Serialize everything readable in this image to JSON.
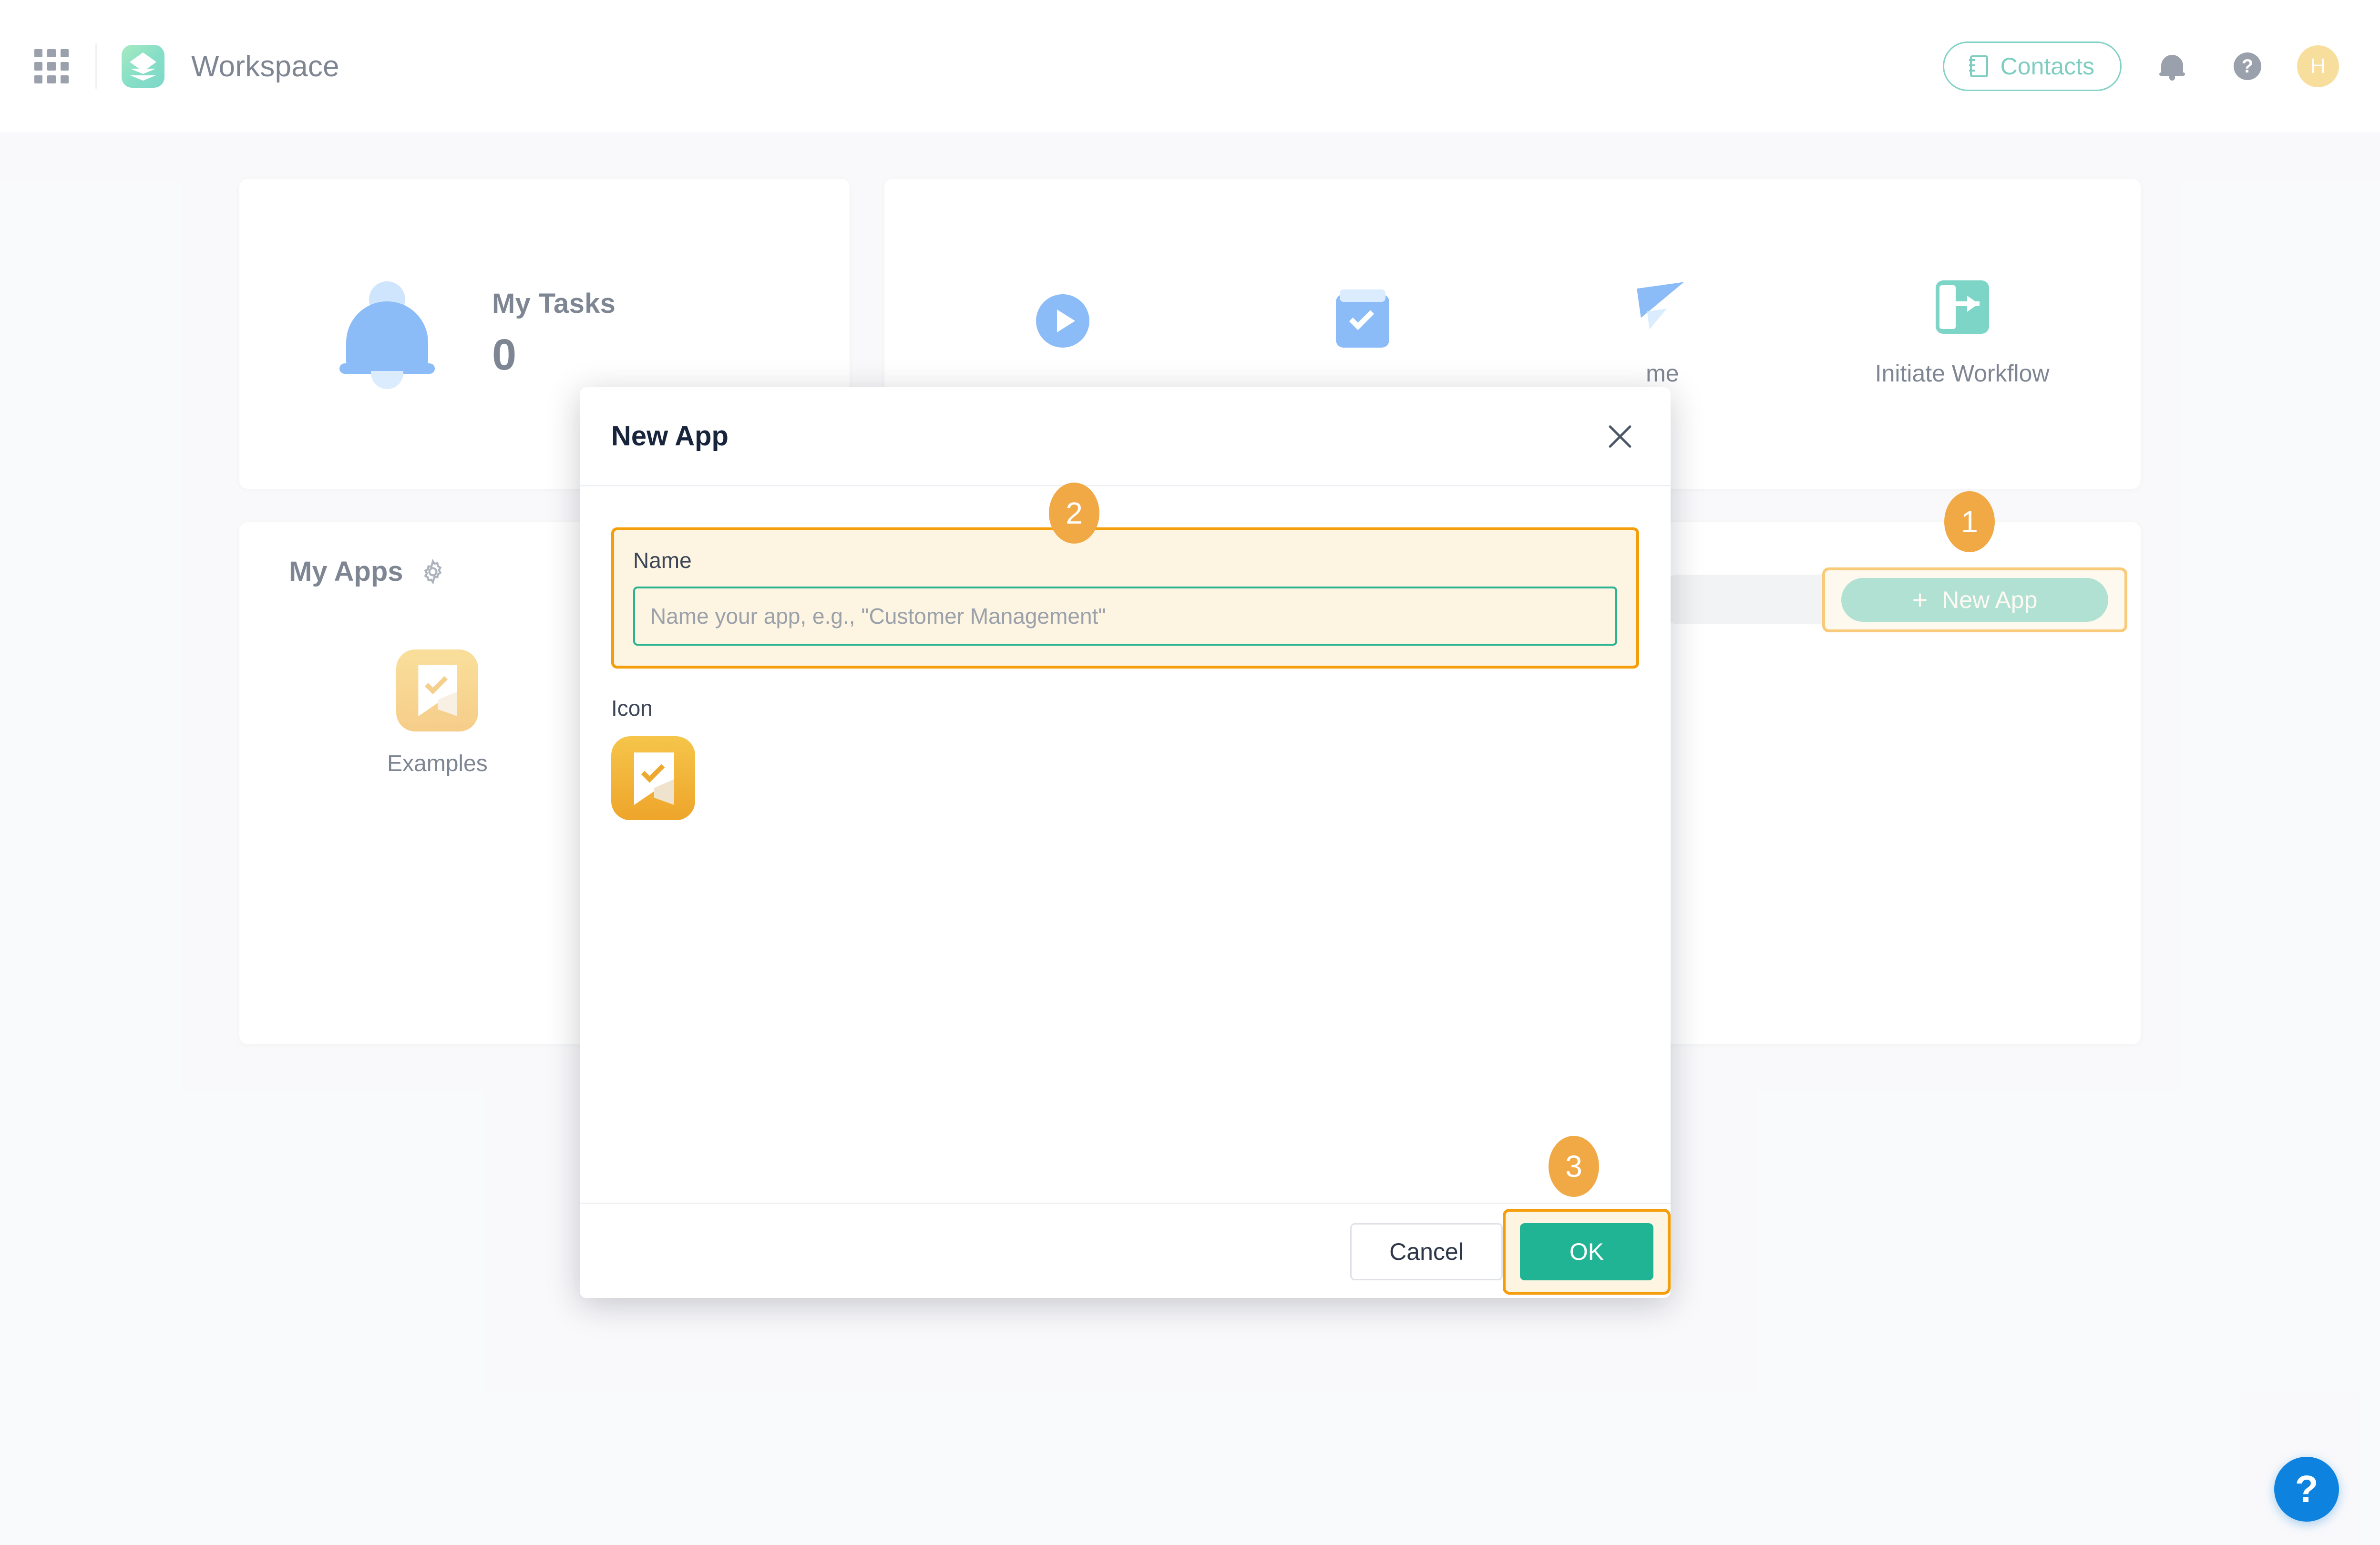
{
  "topbar": {
    "apps_grid_icon": "grid-apps-icon",
    "brand_logo_icon": "workspace-logo-icon",
    "brand_name": "Workspace",
    "contacts_label": "Contacts",
    "contacts_icon": "contacts-book-icon",
    "notifications_icon": "bell-icon",
    "help_icon": "help-circle-icon",
    "avatar_initial": "H"
  },
  "tasks_card": {
    "icon": "bell-icon",
    "title": "My Tasks",
    "count": "0"
  },
  "actions_card": {
    "items": [
      {
        "icon": "play-circle-icon",
        "label": ""
      },
      {
        "icon": "checkbox-inbox-icon",
        "label": ""
      },
      {
        "icon": "paper-plane-icon",
        "label": "me"
      },
      {
        "icon": "initiate-workflow-icon",
        "label": "Initiate Workflow"
      }
    ]
  },
  "apps_card": {
    "title": "My Apps",
    "settings_icon": "gear-icon",
    "apps": [
      {
        "name": "Examples",
        "icon": "bookmark-check-icon"
      }
    ],
    "search_placeholder": "",
    "new_app_label": "New App",
    "new_app_plus": "+"
  },
  "dialog": {
    "title": "New App",
    "close_icon": "close-icon",
    "name_label": "Name",
    "name_value": "",
    "name_placeholder": "Name your app, e.g., \"Customer Management\"",
    "icon_label": "Icon",
    "icon_name": "bookmark-check-icon",
    "cancel_label": "Cancel",
    "ok_label": "OK"
  },
  "markers": {
    "one": "1",
    "two": "2",
    "three": "3"
  },
  "fab": {
    "label": "?",
    "icon": "help-question-icon"
  },
  "colors": {
    "accent_teal": "#21b494",
    "marker_orange": "#f0a945",
    "highlight_border": "#f59e0b",
    "highlight_fill": "#fdf4e1",
    "blue": "#2e86f0",
    "app_icon_amber": "#eea52a",
    "avatar_yellow": "#f2c44c",
    "page_bg": "#f4f5f7"
  }
}
